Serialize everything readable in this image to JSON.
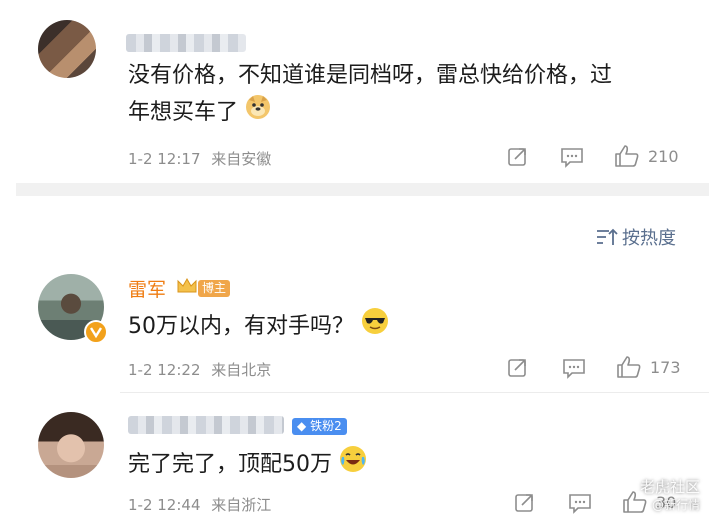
{
  "comments": [
    {
      "author": "",
      "text_line1": "没有价格，不知道谁是同档呀，雷总快给价格，过",
      "text_line2": "年想买车了",
      "emoji": "doge-emoji",
      "time": "1-2 12:17",
      "location": "来自安徽",
      "likes": "210"
    },
    {
      "author": "雷军",
      "badge": "博主",
      "text": "50万以内，有对手吗？",
      "emoji": "sunglasses-emoji",
      "time": "1-2 12:22",
      "location": "来自北京",
      "likes": "173"
    },
    {
      "author": "",
      "badge": "铁粉2",
      "text": "完了完了，顶配50万",
      "emoji": "laugh-cry-emoji",
      "time": "1-2 12:44",
      "location": "来自浙江",
      "likes": "30"
    }
  ],
  "sort": {
    "label": "按热度"
  },
  "watermark": {
    "line1": "老虎社区",
    "line2": "@新行情"
  }
}
